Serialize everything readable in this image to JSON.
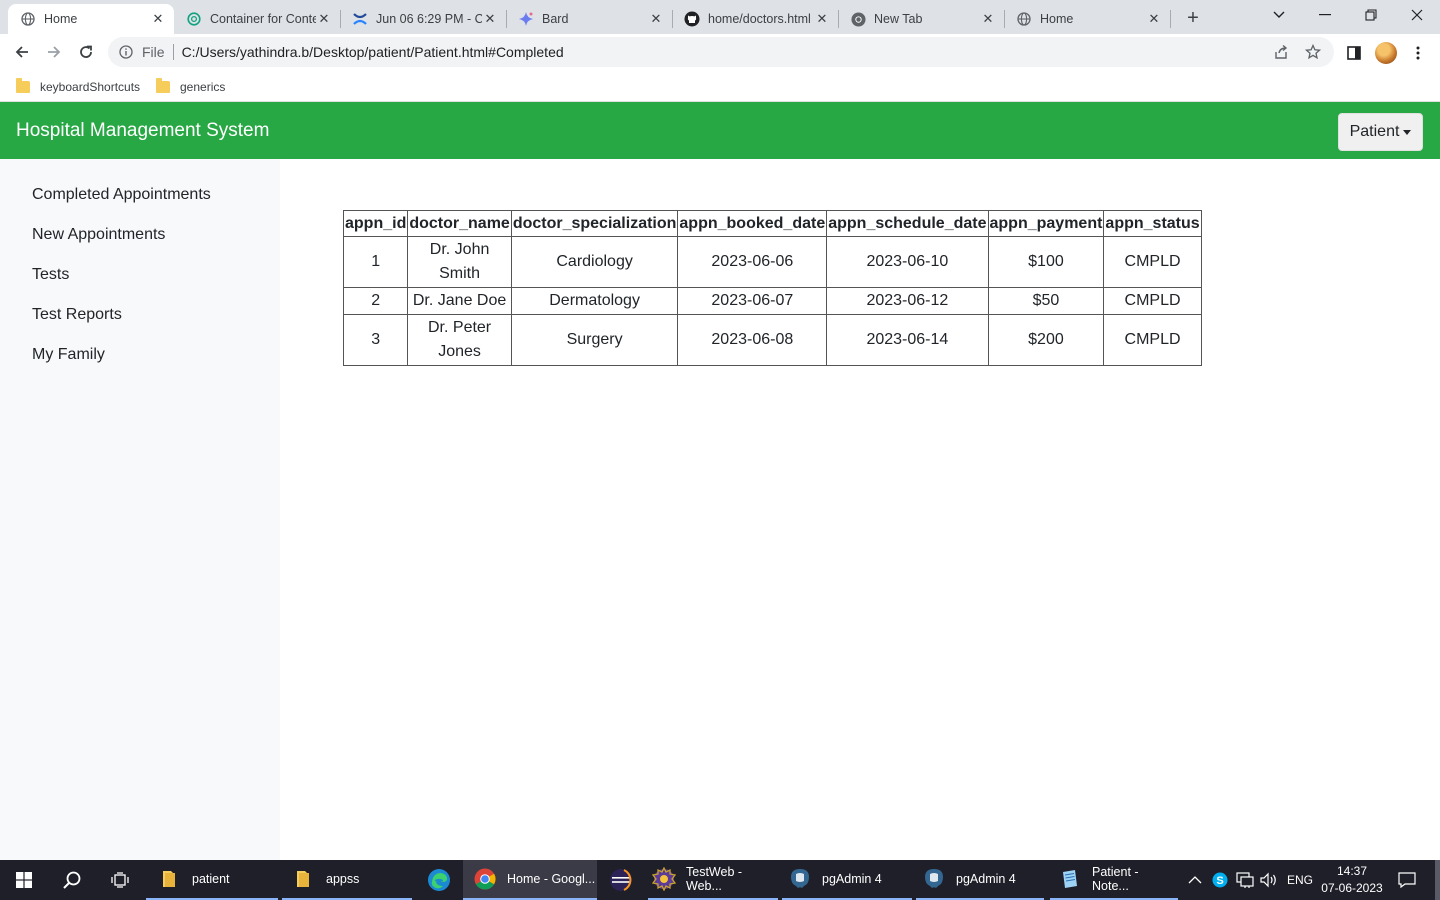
{
  "browser": {
    "tabs": [
      {
        "title": "Home",
        "icon": "globe-icon",
        "active": true
      },
      {
        "title": "Container for Conte",
        "icon": "openai-icon"
      },
      {
        "title": "Jun 06 6:29 PM - C",
        "icon": "confluence-icon"
      },
      {
        "title": "Bard",
        "icon": "bard-sparkle-icon"
      },
      {
        "title": "home/doctors.html",
        "icon": "github-icon"
      },
      {
        "title": "New Tab",
        "icon": "chrome-icon"
      },
      {
        "title": "Home",
        "icon": "globe-icon"
      }
    ],
    "address": {
      "scheme_label": "File",
      "url": "C:/Users/yathindra.b/Desktop/patient/Patient.html#Completed"
    },
    "bookmarks": [
      "keyboardShortcuts",
      "generics"
    ]
  },
  "app": {
    "brand": "Hospital Management System",
    "user_menu": "Patient",
    "accent_color": "#28a745",
    "sidebar": [
      "Completed Appointments",
      "New Appointments",
      "Tests",
      "Test Reports",
      "My Family"
    ],
    "table": {
      "headers": [
        "appn_id",
        "doctor_name",
        "doctor_specialization",
        "appn_booked_date",
        "appn_schedule_date",
        "appn_payment",
        "appn_status"
      ],
      "rows": [
        [
          "1",
          "Dr. John Smith",
          "Cardiology",
          "2023-06-06",
          "2023-06-10",
          "$100",
          "CMPLD"
        ],
        [
          "2",
          "Dr. Jane Doe",
          "Dermatology",
          "2023-06-07",
          "2023-06-12",
          "$50",
          "CMPLD"
        ],
        [
          "3",
          "Dr. Peter Jones",
          "Surgery",
          "2023-06-08",
          "2023-06-14",
          "$200",
          "CMPLD"
        ]
      ]
    }
  },
  "taskbar": {
    "items": [
      {
        "label": "patient",
        "icon": "folder-icon"
      },
      {
        "label": "appss",
        "icon": "folder-icon"
      },
      {
        "label": "",
        "icon": "edge-icon"
      },
      {
        "label": "Home - Googl...",
        "icon": "chrome-icon"
      },
      {
        "label": "",
        "icon": "eclipse-icon"
      },
      {
        "label": "TestWeb - Web...",
        "icon": "eclipse-web-icon"
      },
      {
        "label": "pgAdmin 4",
        "icon": "pgadmin-icon"
      },
      {
        "label": "pgAdmin 4",
        "icon": "pgadmin-icon"
      },
      {
        "label": "Patient - Note...",
        "icon": "notepad-icon"
      }
    ],
    "language": "ENG",
    "time": "14:37",
    "date": "07-06-2023"
  }
}
